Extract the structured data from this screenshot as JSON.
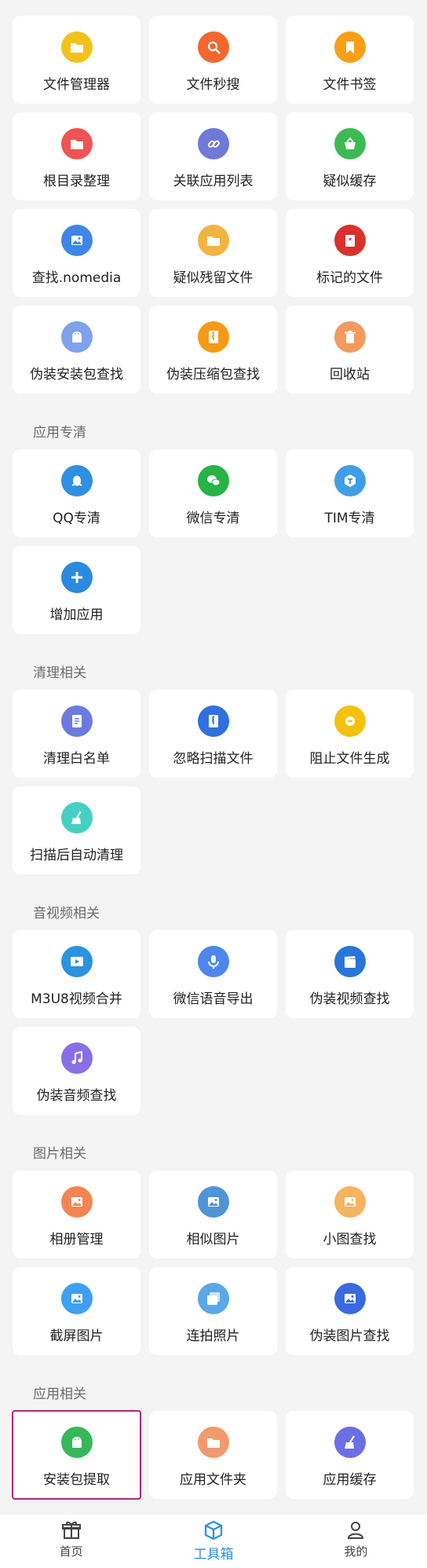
{
  "colors": {
    "accent": "#2e8fdc",
    "selection": "#b3247a"
  },
  "sections": [
    {
      "title": "",
      "items": [
        {
          "label": "文件管理器",
          "icon": "folder-icon",
          "color": "#f3c21a"
        },
        {
          "label": "文件秒搜",
          "icon": "search-icon",
          "color": "#f4672e"
        },
        {
          "label": "文件书签",
          "icon": "bookmark-icon",
          "color": "#f7a017"
        },
        {
          "label": "根目录整理",
          "icon": "folder-icon",
          "color": "#ef5353"
        },
        {
          "label": "关联应用列表",
          "icon": "link-icon",
          "color": "#6f79d6"
        },
        {
          "label": "疑似缓存",
          "icon": "basket-icon",
          "color": "#3cbb55"
        },
        {
          "label": "查找.nomedia",
          "icon": "image-icon",
          "color": "#3e86e6"
        },
        {
          "label": "疑似残留文件",
          "icon": "folder-icon",
          "color": "#f3b341"
        },
        {
          "label": "标记的文件",
          "icon": "file-marked-icon",
          "color": "#d9312c"
        },
        {
          "label": "伪装安装包查找",
          "icon": "android-icon",
          "color": "#7ea2ec"
        },
        {
          "label": "伪装压缩包查找",
          "icon": "zip-icon",
          "color": "#f59a17"
        },
        {
          "label": "回收站",
          "icon": "trash-icon",
          "color": "#f39a5f"
        }
      ]
    },
    {
      "title": "应用专清",
      "items": [
        {
          "label": "QQ专清",
          "icon": "qq-icon",
          "color": "#2f8fe2"
        },
        {
          "label": "微信专清",
          "icon": "wechat-icon",
          "color": "#27b345"
        },
        {
          "label": "TIM专清",
          "icon": "tim-icon",
          "color": "#3e9ee8"
        },
        {
          "label": "增加应用",
          "icon": "plus-icon",
          "color": "#2a8ae0"
        }
      ]
    },
    {
      "title": "清理相关",
      "items": [
        {
          "label": "清理白名单",
          "icon": "list-icon",
          "color": "#6c7ae0"
        },
        {
          "label": "忽略扫描文件",
          "icon": "zip-icon",
          "color": "#3170e0"
        },
        {
          "label": "阻止文件生成",
          "icon": "minus-icon",
          "color": "#f4c20d"
        },
        {
          "label": "扫描后自动清理",
          "icon": "broom-icon",
          "color": "#45d0c4"
        }
      ]
    },
    {
      "title": "音视频相关",
      "items": [
        {
          "label": "M3U8视频合并",
          "icon": "video-icon",
          "color": "#2a93e2"
        },
        {
          "label": "微信语音导出",
          "icon": "mic-icon",
          "color": "#4e86ec"
        },
        {
          "label": "伪装视频查找",
          "icon": "clapper-icon",
          "color": "#2776d8"
        },
        {
          "label": "伪装音频查找",
          "icon": "music-icon",
          "color": "#8a6ee6"
        }
      ]
    },
    {
      "title": "图片相关",
      "items": [
        {
          "label": "相册管理",
          "icon": "image-icon",
          "color": "#f38553"
        },
        {
          "label": "相似图片",
          "icon": "image-icon",
          "color": "#4f94d8"
        },
        {
          "label": "小图查找",
          "icon": "image-icon",
          "color": "#f6b45e"
        },
        {
          "label": "截屏图片",
          "icon": "image-icon",
          "color": "#3f9ff0"
        },
        {
          "label": "连拍照片",
          "icon": "burst-icon",
          "color": "#5aa8e8"
        },
        {
          "label": "伪装图片查找",
          "icon": "image-icon",
          "color": "#3b69e0"
        }
      ]
    },
    {
      "title": "应用相关",
      "items": [
        {
          "label": "安装包提取",
          "icon": "android-icon",
          "color": "#37b75a",
          "selected": true
        },
        {
          "label": "应用文件夹",
          "icon": "folder-icon",
          "color": "#f29a6e"
        },
        {
          "label": "应用缓存",
          "icon": "broom-icon",
          "color": "#6b6fe4"
        }
      ]
    }
  ],
  "tabbar": {
    "items": [
      {
        "label": "首页",
        "icon": "gift-icon",
        "active": false
      },
      {
        "label": "工具箱",
        "icon": "box-icon",
        "active": true
      },
      {
        "label": "我的",
        "icon": "person-icon",
        "active": false
      }
    ]
  }
}
